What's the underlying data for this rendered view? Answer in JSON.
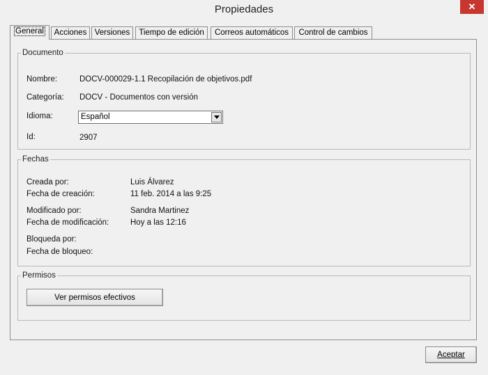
{
  "window": {
    "title": "Propiedades",
    "close_glyph": "✕"
  },
  "tabs": [
    {
      "label": "General",
      "active": true
    },
    {
      "label": "Acciones"
    },
    {
      "label": "Versiones"
    },
    {
      "label": "Tiempo de edición"
    },
    {
      "label": "Correos automáticos"
    },
    {
      "label": "Control de cambios"
    }
  ],
  "documento": {
    "legend": "Documento",
    "name_label": "Nombre:",
    "name_value": "DOCV-000029-1.1 Recopilación de objetivos.pdf",
    "category_label": "Categoría:",
    "category_value": "DOCV - Documentos con versión",
    "language_label": "Idioma:",
    "language_value": "Español",
    "id_label": "Id:",
    "id_value": "2907"
  },
  "fechas": {
    "legend": "Fechas",
    "created_by_label": "Creada por:",
    "created_by_value": "Luis Álvarez",
    "created_date_label": "Fecha de creación:",
    "created_date_value": "11 feb. 2014 a las 9:25",
    "modified_by_label": "Modificado por:",
    "modified_by_value": "Sandra Martinez",
    "modified_date_label": "Fecha de modificación:",
    "modified_date_value": "Hoy a las 12:16",
    "locked_by_label": "Bloqueda por:",
    "locked_date_label": "Fecha de bloqueo:"
  },
  "permisos": {
    "legend": "Permisos",
    "button_label": "Ver permisos efectivos"
  },
  "footer": {
    "accept_label": "Aceptar"
  }
}
